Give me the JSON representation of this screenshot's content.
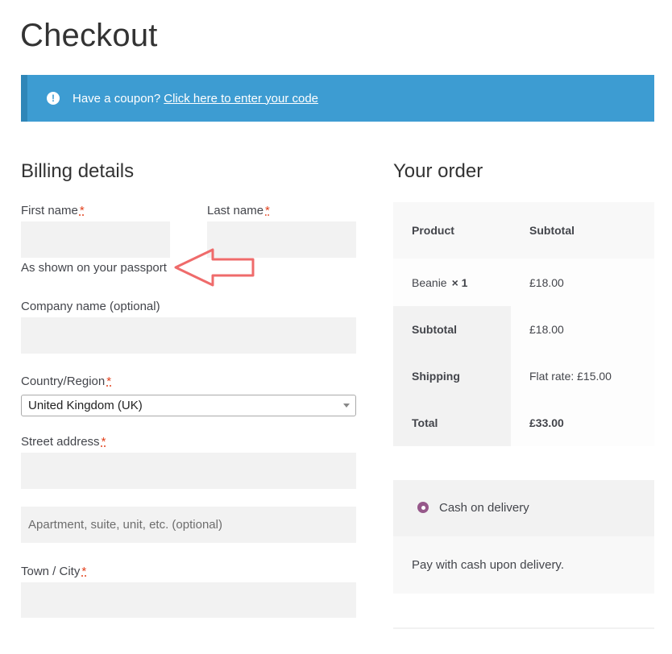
{
  "page_title": "Checkout",
  "notice": {
    "text": "Have a coupon?",
    "link": "Click here to enter your code"
  },
  "billing": {
    "heading": "Billing details",
    "first_name_label": "First name",
    "last_name_label": "Last name",
    "required_mark": "*",
    "passport_hint": "As shown on your passport",
    "company_label": "Company name (optional)",
    "country_label": "Country/Region",
    "country_value": "United Kingdom (UK)",
    "street_label": "Street address",
    "apartment_placeholder": "Apartment, suite, unit, etc. (optional)",
    "city_label": "Town / City"
  },
  "order": {
    "heading": "Your order",
    "col_product": "Product",
    "col_subtotal": "Subtotal",
    "item_name": "Beanie",
    "item_qty": "× 1",
    "item_price": "£18.00",
    "subtotal_label": "Subtotal",
    "subtotal_value": "£18.00",
    "shipping_label": "Shipping",
    "shipping_value": "Flat rate: £15.00",
    "total_label": "Total",
    "total_value": "£33.00"
  },
  "payment": {
    "method_label": "Cash on delivery",
    "description": "Pay with cash upon delivery."
  },
  "colors": {
    "notice_bg": "#3d9cd2",
    "required": "#e2401c",
    "radio_accent": "#96588a",
    "annotation_arrow": "#ef6b6b"
  }
}
